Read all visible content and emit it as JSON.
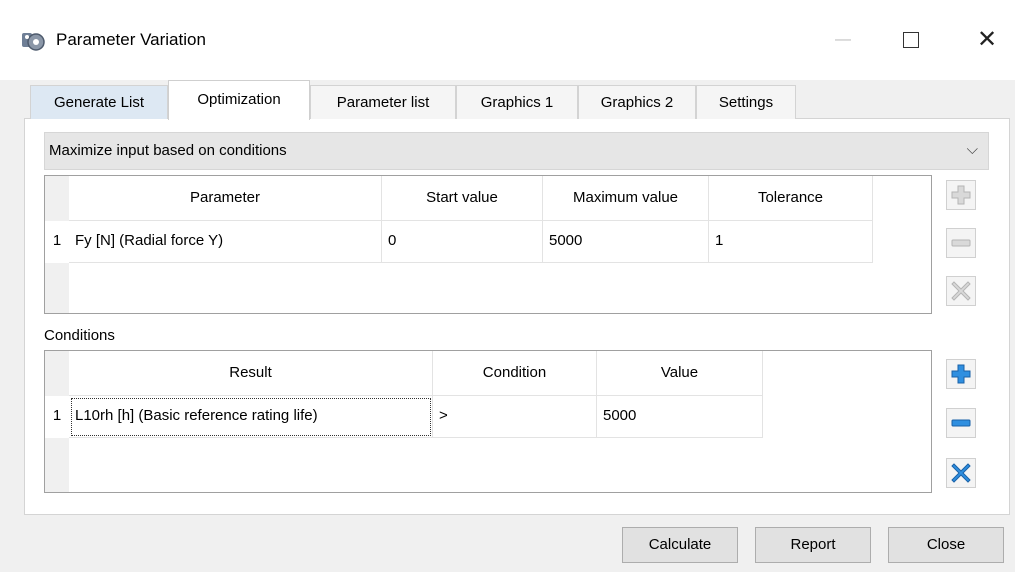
{
  "window": {
    "title": "Parameter Variation",
    "minimize_glyph": "—",
    "close_glyph": "✕"
  },
  "tabs": [
    {
      "label": "Generate List"
    },
    {
      "label": "Optimization",
      "active": true
    },
    {
      "label": "Parameter list"
    },
    {
      "label": "Graphics 1"
    },
    {
      "label": "Graphics 2"
    },
    {
      "label": "Settings"
    }
  ],
  "mode": {
    "selected": "Maximize input based on conditions",
    "chevron": "⌵"
  },
  "parameters": {
    "columns": [
      "Parameter",
      "Start value",
      "Maximum value",
      "Tolerance"
    ],
    "rows": [
      {
        "num": "1",
        "parameter": "Fy [N]  (Radial force Y)",
        "start": "0",
        "max": "5000",
        "tolerance": "1"
      }
    ]
  },
  "conditions": {
    "label": "Conditions",
    "columns": [
      "Result",
      "Condition",
      "Value"
    ],
    "rows": [
      {
        "num": "1",
        "result": "L10rh [h]  (Basic reference rating life)",
        "condition": ">",
        "value": "5000"
      }
    ]
  },
  "side_buttons": {
    "parameters": {
      "add_icon": "plus-icon",
      "remove_icon": "minus-icon",
      "delete_icon": "x-icon",
      "enabled": false
    },
    "conditions": {
      "add_icon": "plus-icon",
      "remove_icon": "minus-icon",
      "delete_icon": "x-icon",
      "enabled": true
    }
  },
  "buttons": {
    "calculate": "Calculate",
    "report": "Report",
    "close": "Close"
  },
  "colors": {
    "accent": "#2f8fe0",
    "disabled": "#c8c8c8",
    "tab_first_bg": "#dde8f3"
  }
}
